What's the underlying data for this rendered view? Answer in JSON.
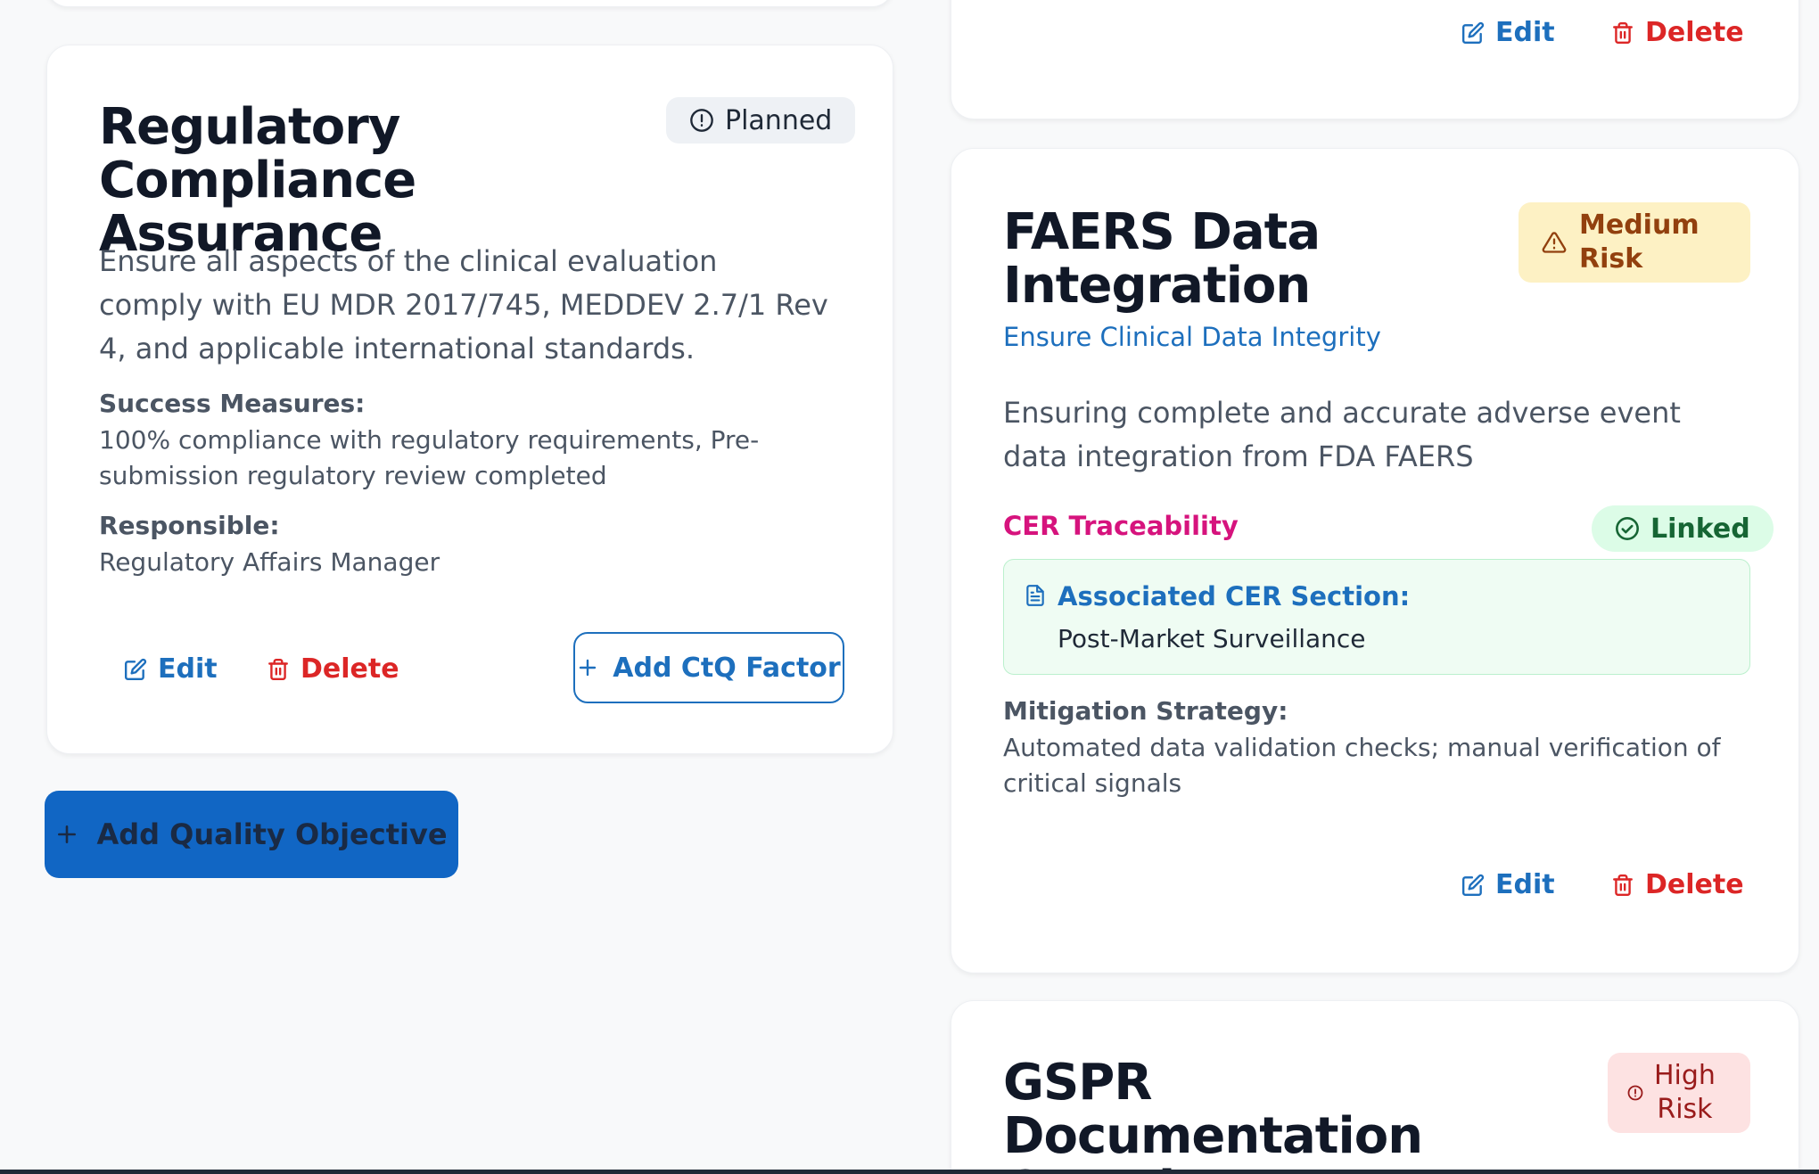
{
  "colors": {
    "primary": "#1166c4",
    "danger": "#dc2626",
    "pink": "#d6137d",
    "success_bg": "#dcfce7",
    "warning_bg": "#fdf1c4",
    "danger_bg": "#fde2e2"
  },
  "top_right_card": {
    "edit_label": "Edit",
    "delete_label": "Delete"
  },
  "objective_card": {
    "title": "Regulatory Compliance Assurance",
    "status": "Planned",
    "description": "Ensure all aspects of the clinical evaluation comply with EU MDR 2017/745, MEDDEV 2.7/1 Rev 4, and applicable international standards.",
    "success_label": "Success Measures:",
    "success_value": "100% compliance with regulatory requirements, Pre-submission regulatory review completed",
    "responsible_label": "Responsible:",
    "responsible_value": "Regulatory Affairs Manager",
    "edit_label": "Edit",
    "delete_label": "Delete",
    "add_ctq_label": "Add CtQ Factor"
  },
  "add_objective_label": "Add Quality Objective",
  "faers_card": {
    "title": "FAERS Data Integration",
    "risk_line1": "Medium",
    "risk_line2": "Risk",
    "objective_link": "Ensure Clinical Data Integrity",
    "description": "Ensuring complete and accurate adverse event data integration from FDA FAERS",
    "traceability_label": "CER Traceability",
    "linked_label": "Linked",
    "cer_section_label": "Associated CER Section:",
    "cer_section_value": "Post-Market Surveillance",
    "mitigation_label": "Mitigation Strategy:",
    "mitigation_value": "Automated data validation checks; manual verification of critical signals",
    "edit_label": "Edit",
    "delete_label": "Delete"
  },
  "gspr_card": {
    "title": "GSPR Documentation Completeness",
    "risk_line1": "High",
    "risk_line2": "Risk"
  }
}
